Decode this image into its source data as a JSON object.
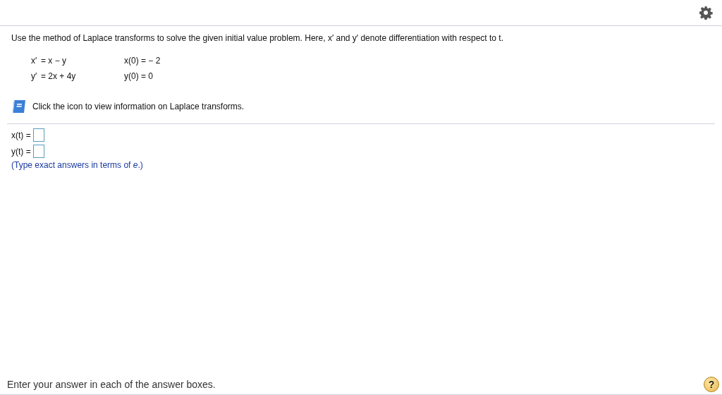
{
  "question": "Use the method of Laplace transforms to solve the given initial value problem. Here, x′ and y′ denote differentiation with respect to t.",
  "equations": [
    {
      "lhs": "x′",
      "rhs": "=  x − y",
      "initial": "x(0) =  − 2"
    },
    {
      "lhs": "y′",
      "rhs": "=  2x + 4y",
      "initial": "y(0) = 0"
    }
  ],
  "info_text": "Click the icon to view information on Laplace transforms.",
  "answers": [
    {
      "label": "x(t) ="
    },
    {
      "label": "y(t) ="
    }
  ],
  "hint": "(Type exact answers in terms of *e*.)",
  "footer": "Enter your answer in each of the answer boxes.",
  "help_label": "?"
}
